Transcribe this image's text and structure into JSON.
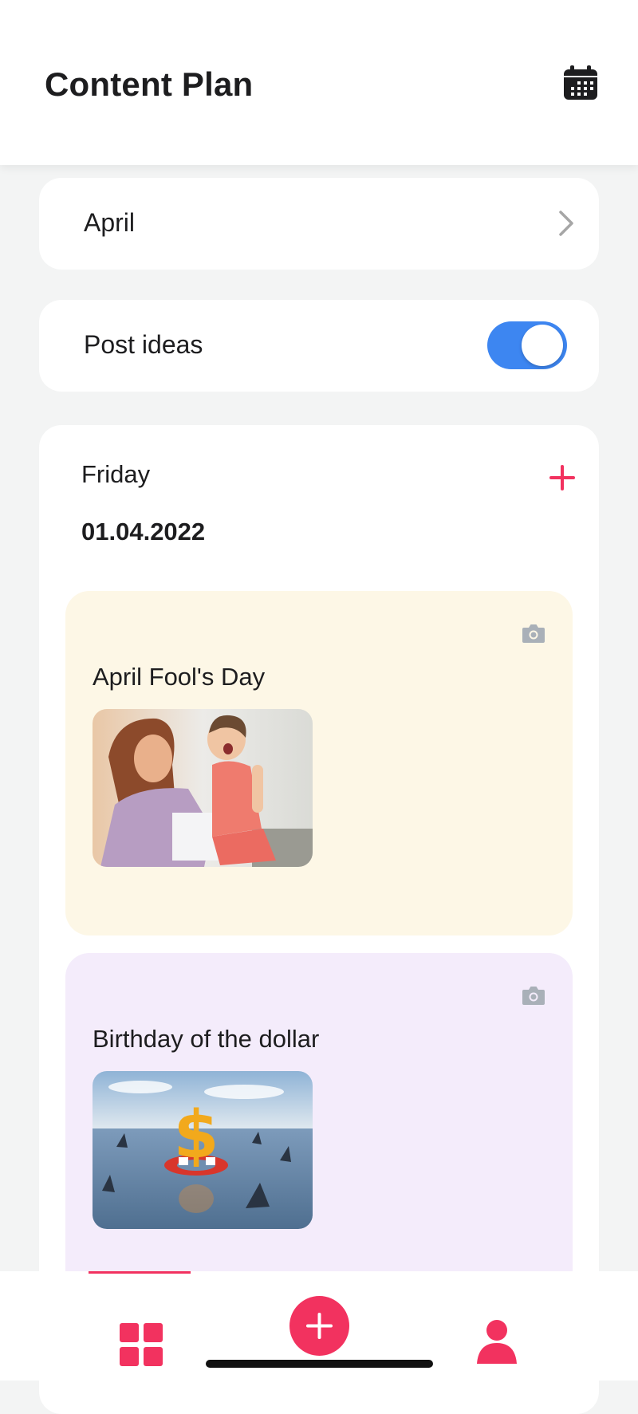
{
  "header": {
    "title": "Content Plan",
    "calendar_icon": "calendar-icon"
  },
  "month_selector": {
    "label": "April",
    "icon": "chevron-right-icon"
  },
  "post_ideas": {
    "label": "Post ideas",
    "toggle_on": true,
    "toggle_color": "#3d86f1"
  },
  "day": {
    "weekday": "Friday",
    "date": "01.04.2022",
    "add_icon": "plus-icon",
    "posts": [
      {
        "title": "April Fool's Day",
        "background": "#fdf7e6",
        "icon": "camera-icon",
        "image": "mother-and-daughter-photo"
      },
      {
        "title": "Birthday of the dollar",
        "background": "#f4ecfb",
        "icon": "camera-icon",
        "image": "dollar-sign-with-sharks-photo"
      }
    ]
  },
  "bottom_nav": {
    "accent": "#f2325f",
    "items": [
      {
        "name": "grid-icon",
        "active": true
      },
      {
        "name": "add-post-button"
      },
      {
        "name": "profile-icon"
      }
    ]
  }
}
